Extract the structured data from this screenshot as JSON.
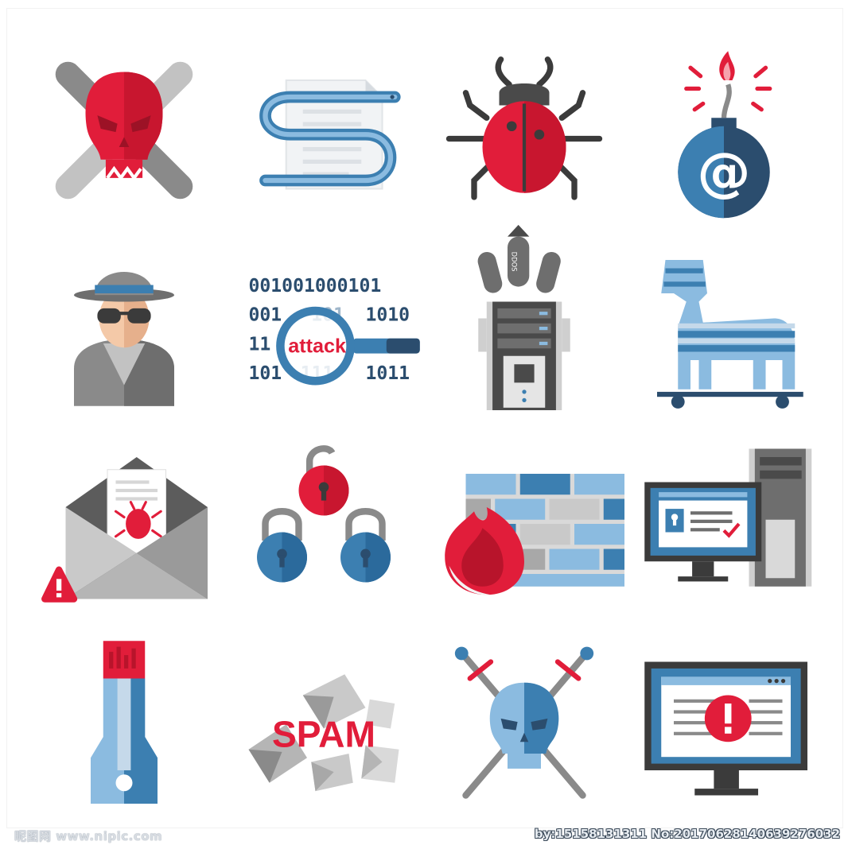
{
  "colors": {
    "red": "#e11d3a",
    "dark_red": "#b8142b",
    "blue": "#3c7fb1",
    "dark_blue": "#2b4d6e",
    "light_blue": "#8bbbe0",
    "gray": "#8a8a8a",
    "light_gray": "#c9c9c9",
    "dark": "#3b3b3b"
  },
  "icons": [
    {
      "name": "skull-crossbones-icon"
    },
    {
      "name": "worm-document-icon"
    },
    {
      "name": "bug-icon"
    },
    {
      "name": "email-bomb-icon"
    },
    {
      "name": "hacker-spy-icon"
    },
    {
      "name": "binary-attack-magnifier-icon"
    },
    {
      "name": "ddos-server-icon"
    },
    {
      "name": "trojan-horse-icon"
    },
    {
      "name": "infected-email-icon"
    },
    {
      "name": "padlocks-icon"
    },
    {
      "name": "firewall-icon"
    },
    {
      "name": "secure-computer-icon"
    },
    {
      "name": "usb-key-icon"
    },
    {
      "name": "spam-envelopes-icon"
    },
    {
      "name": "skull-swords-icon"
    },
    {
      "name": "monitor-alert-icon"
    }
  ],
  "binary": {
    "row1": "001001000101",
    "row2a": "001",
    "row2b": "101",
    "row2c": "1010",
    "row3a": "11",
    "row4a": "101",
    "row4b": "111",
    "row4c": "1011",
    "magnifier_word": "attack"
  },
  "email_bomb_symbol": "@",
  "ddos_label": "DDOS",
  "spam_label": "SPAM",
  "watermark": {
    "left": "昵图网 www.nipic.com",
    "right": "by:15158131311 No:20170628140639276032"
  }
}
